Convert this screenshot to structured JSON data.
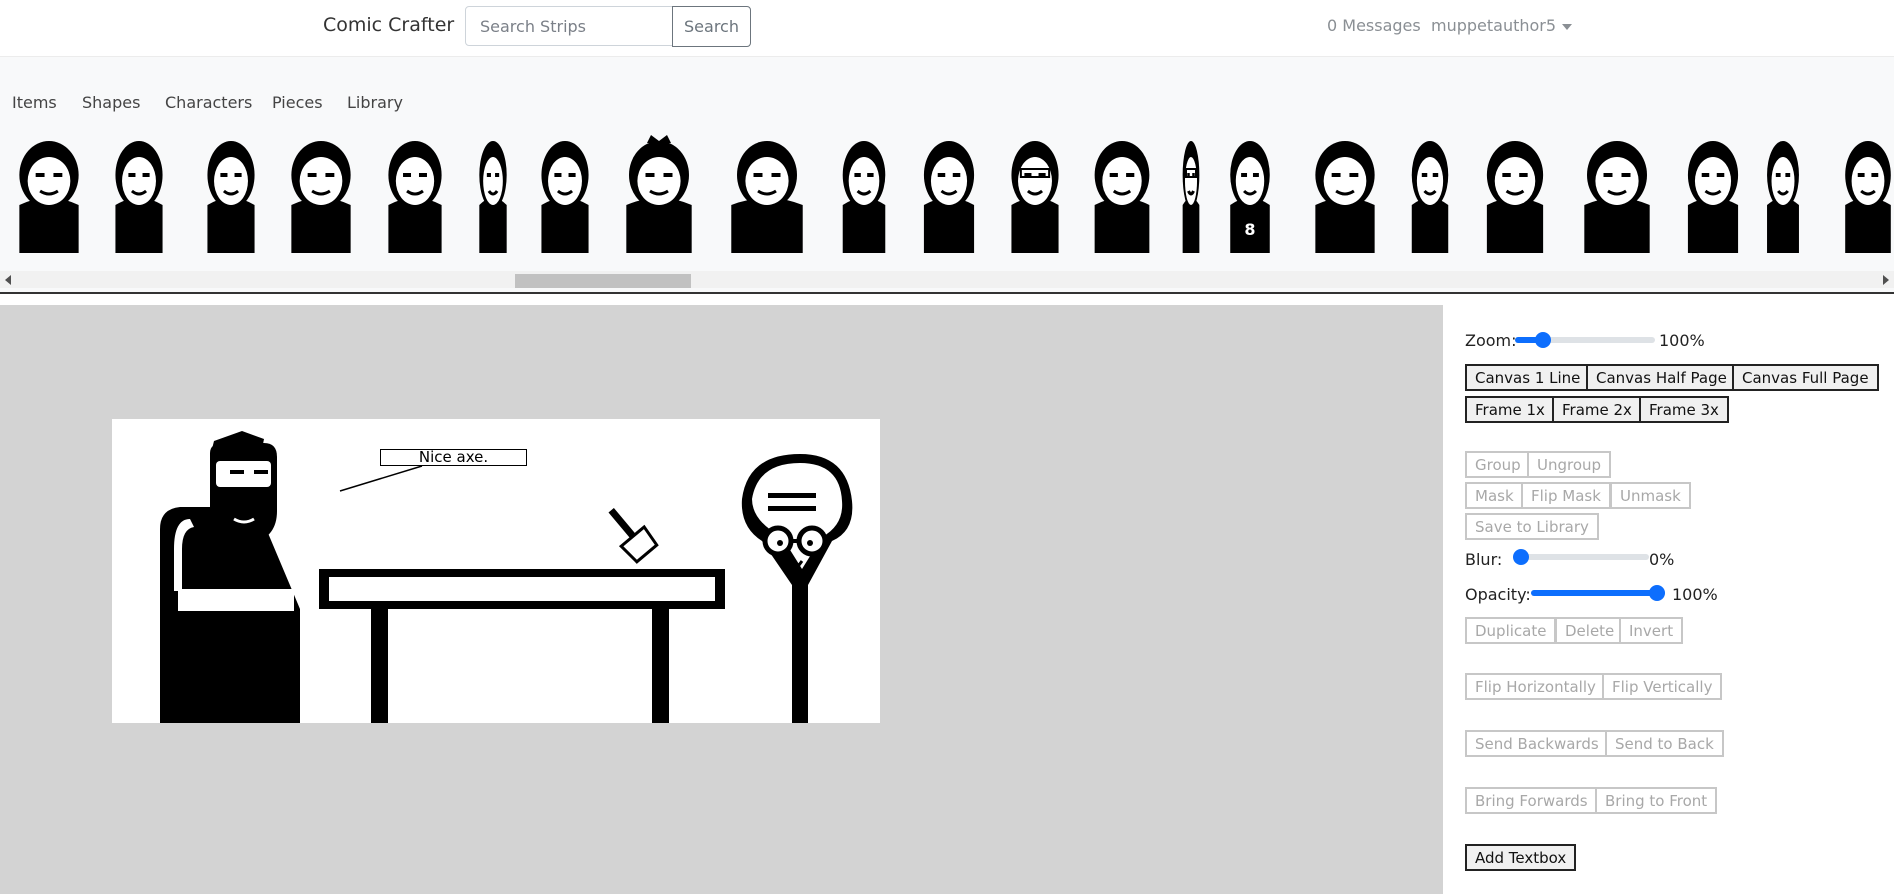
{
  "navbar": {
    "brand": "Comic Crafter",
    "search_placeholder": "Search Strips",
    "search_button": "Search",
    "messages": "0 Messages",
    "username": "muppetauthor5"
  },
  "tabs": [
    "Items",
    "Shapes",
    "Characters",
    "Pieces",
    "Library"
  ],
  "characters": [
    {
      "name": "character-cap-girl",
      "type": "cap"
    },
    {
      "name": "character-brooding-man",
      "type": "brood"
    },
    {
      "name": "character-profile-man",
      "type": "profile"
    },
    {
      "name": "character-star-hat",
      "type": "star"
    },
    {
      "name": "character-long-hair-woman",
      "type": "longhair"
    },
    {
      "name": "character-slim-man",
      "type": "slim"
    },
    {
      "name": "character-headphones-man",
      "type": "headphones"
    },
    {
      "name": "character-crowned-blob",
      "type": "crown"
    },
    {
      "name": "character-vampire-collar",
      "type": "collar"
    },
    {
      "name": "character-suspenders-man",
      "type": "suspenders"
    },
    {
      "name": "character-bearded-man",
      "type": "beard"
    },
    {
      "name": "character-glasses-man",
      "type": "glasses"
    },
    {
      "name": "character-bob-hair-girl",
      "type": "bob"
    },
    {
      "name": "character-thin-tie-man",
      "type": "thintie"
    },
    {
      "name": "character-jersey-player",
      "type": "jersey",
      "label": "8"
    },
    {
      "name": "character-side-hair",
      "type": "sidehair"
    },
    {
      "name": "character-bald-beard-man",
      "type": "baldbeard"
    },
    {
      "name": "character-dracula",
      "type": "dracula"
    },
    {
      "name": "character-hooded-figure",
      "type": "hood"
    },
    {
      "name": "character-square-head",
      "type": "square"
    },
    {
      "name": "character-spiky-hair",
      "type": "spiky"
    },
    {
      "name": "character-suit-man",
      "type": "suit"
    }
  ],
  "canvas": {
    "speech_bubble": "Nice axe."
  },
  "panel": {
    "zoom_label": "Zoom:",
    "zoom_value": "100%",
    "zoom_level": 0.2,
    "canvas_buttons": [
      "Canvas 1 Line",
      "Canvas Half Page",
      "Canvas Full Page"
    ],
    "frame_buttons": [
      "Frame 1x",
      "Frame 2x",
      "Frame 3x"
    ],
    "group": "Group",
    "ungroup": "Ungroup",
    "mask": "Mask",
    "flip_mask": "Flip Mask",
    "unmask": "Unmask",
    "save_library": "Save to Library",
    "blur_label": "Blur:",
    "blur_value": "0%",
    "blur_level": 0,
    "opacity_label": "Opacity:",
    "opacity_value": "100%",
    "opacity_level": 1,
    "duplicate": "Duplicate",
    "delete": "Delete",
    "invert": "Invert",
    "flip_h": "Flip Horizontally",
    "flip_v": "Flip Vertically",
    "send_backwards": "Send Backwards",
    "send_back": "Send to Back",
    "bring_forwards": "Bring Forwards",
    "bring_front": "Bring to Front",
    "add_textbox": "Add Textbox"
  }
}
